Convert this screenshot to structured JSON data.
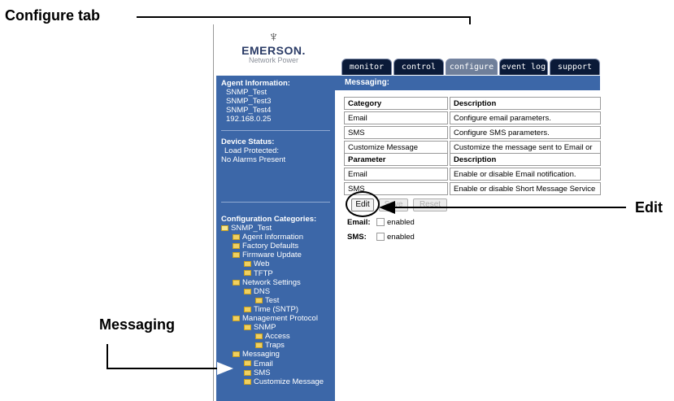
{
  "callouts": {
    "configure_tab": "Configure tab",
    "edit": "Edit",
    "messaging": "Messaging"
  },
  "logo": {
    "mark": "♆",
    "name": "EMERSON.",
    "sub": "Network Power"
  },
  "tabs": [
    {
      "label": "monitor",
      "active": false
    },
    {
      "label": "control",
      "active": false
    },
    {
      "label": "configure",
      "active": true
    },
    {
      "label": "event log",
      "active": false
    },
    {
      "label": "support",
      "active": false
    }
  ],
  "sidebar": {
    "agent_heading": "Agent Information:",
    "agent_lines": [
      "SNMP_Test",
      "SNMP_Test3",
      "SNMP_Test4",
      "192.168.0.25"
    ],
    "device_heading": "Device Status:",
    "device_lines": [
      "Load Protected:",
      "No Alarms Present"
    ],
    "config_heading": "Configuration Categories:",
    "tree": [
      {
        "label": "SNMP_Test",
        "level": 0
      },
      {
        "label": "Agent Information",
        "level": 1
      },
      {
        "label": "Factory Defaults",
        "level": 1
      },
      {
        "label": "Firmware Update",
        "level": 1
      },
      {
        "label": "Web",
        "level": 2
      },
      {
        "label": "TFTP",
        "level": 2
      },
      {
        "label": "Network Settings",
        "level": 1
      },
      {
        "label": "DNS",
        "level": 2
      },
      {
        "label": "Test",
        "level": 3
      },
      {
        "label": "Time (SNTP)",
        "level": 2
      },
      {
        "label": "Management Protocol",
        "level": 1
      },
      {
        "label": "SNMP",
        "level": 2
      },
      {
        "label": "Access",
        "level": 3
      },
      {
        "label": "Traps",
        "level": 3
      },
      {
        "label": "Messaging",
        "level": 1
      },
      {
        "label": "Email",
        "level": 2
      },
      {
        "label": "SMS",
        "level": 2
      },
      {
        "label": "Customize Message",
        "level": 2
      }
    ]
  },
  "content": {
    "heading": "Messaging:",
    "category_table": {
      "headers": [
        "Category",
        "Description"
      ],
      "rows": [
        [
          "Email",
          "Configure email parameters."
        ],
        [
          "SMS",
          "Configure SMS parameters."
        ],
        [
          "Customize Message",
          "Customize the message sent to Email or"
        ]
      ]
    },
    "parameter_table": {
      "headers": [
        "Parameter",
        "Description"
      ],
      "rows": [
        [
          "Email",
          "Enable or disable Email notification."
        ],
        [
          "SMS",
          "Enable or disable Short Message Service"
        ]
      ]
    },
    "buttons": {
      "edit": "Edit",
      "save": "Save",
      "reset": "Reset"
    },
    "settings": [
      {
        "label": "Email:",
        "value": "enabled",
        "checked": false
      },
      {
        "label": "SMS:",
        "value": "enabled",
        "checked": false
      }
    ]
  }
}
